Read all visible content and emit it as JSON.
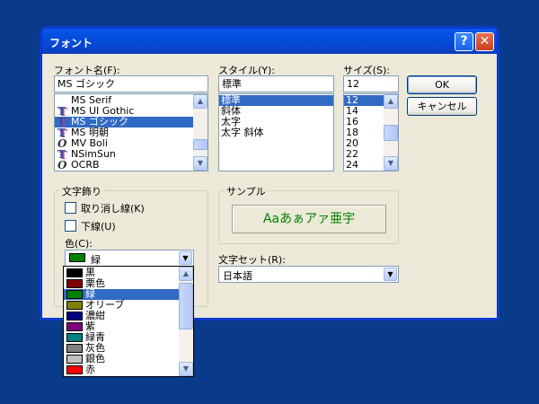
{
  "window": {
    "title": "フォント",
    "help_label": "?",
    "close_label": "✕"
  },
  "font_name": {
    "label": "フォント名(F):",
    "value": "MS ゴシック",
    "items": [
      {
        "name": "MS Serif",
        "icon": "none"
      },
      {
        "name": "MS UI Gothic",
        "icon": "truetype"
      },
      {
        "name": "MS ゴシック",
        "icon": "truetype",
        "selected": true
      },
      {
        "name": "MS 明朝",
        "icon": "truetype"
      },
      {
        "name": "MV Boli",
        "icon": "opentype"
      },
      {
        "name": "NSimSun",
        "icon": "truetype"
      },
      {
        "name": "OCRB",
        "icon": "opentype"
      }
    ]
  },
  "style": {
    "label": "スタイル(Y):",
    "value": "標準",
    "items": [
      "標準",
      "斜体",
      "太字",
      "太字 斜体"
    ],
    "selected_index": 0
  },
  "size": {
    "label": "サイズ(S):",
    "value": "12",
    "items": [
      "12",
      "14",
      "16",
      "18",
      "20",
      "22",
      "24"
    ],
    "selected_index": 0
  },
  "buttons": {
    "ok": "OK",
    "cancel": "キャンセル"
  },
  "effects": {
    "legend": "文字飾り",
    "strikeout": "取り消し線(K)",
    "underline": "下線(U)",
    "color_label": "色(C):",
    "color_value": "緑",
    "color_value_hex": "#008000"
  },
  "sample": {
    "legend": "サンプル",
    "text": "Aaあぁアァ亜宇",
    "text_color": "#008000"
  },
  "charset": {
    "label": "文字セット(R):",
    "value": "日本語"
  },
  "color_options": [
    {
      "name": "黒",
      "hex": "#000000"
    },
    {
      "name": "栗色",
      "hex": "#800000"
    },
    {
      "name": "緑",
      "hex": "#008000",
      "selected": true
    },
    {
      "name": "オリーブ",
      "hex": "#808000"
    },
    {
      "name": "濃紺",
      "hex": "#000080"
    },
    {
      "name": "紫",
      "hex": "#800080"
    },
    {
      "name": "緑青",
      "hex": "#008080"
    },
    {
      "name": "灰色",
      "hex": "#808080"
    },
    {
      "name": "銀色",
      "hex": "#c0c0c0"
    },
    {
      "name": "赤",
      "hex": "#ff0000"
    }
  ],
  "colors": {
    "titlebar": "#0a5ce8",
    "selection": "#316ac5",
    "desktop": "#0a3a8a",
    "dialog": "#ece9d8"
  }
}
